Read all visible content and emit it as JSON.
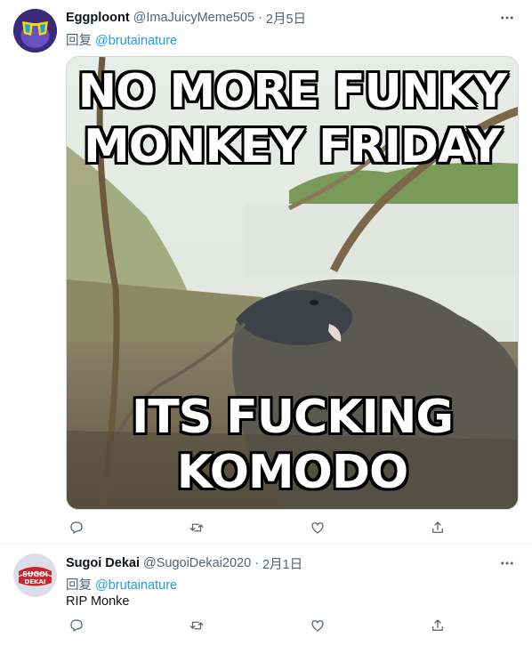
{
  "tweets": [
    {
      "display_name": "Eggploont",
      "handle": "@ImaJuicyMeme505",
      "separator": "·",
      "date": "2月5日",
      "reply_prefix": "回复",
      "reply_to": "@brutainature",
      "text": "",
      "media": {
        "top_caption": "NO MORE FUNKY MONKEY FRIDAY",
        "bottom_caption": "ITS FUCKING KOMODO"
      }
    },
    {
      "display_name": "Sugoi Dekai",
      "handle": "@SugoiDekai2020",
      "separator": "·",
      "date": "2月1日",
      "reply_prefix": "回复",
      "reply_to": "@brutainature",
      "text": "RIP Monke",
      "avatar_text_top": "SUGOI",
      "avatar_text_bottom": "DEKAI"
    }
  ],
  "icons": {
    "more": "more-icon",
    "reply": "reply-icon",
    "retweet": "retweet-icon",
    "like": "heart-icon",
    "share": "share-icon"
  },
  "colors": {
    "accent": "#1d9bf0",
    "secondary_text": "#536471",
    "divider": "#eff3f4"
  }
}
